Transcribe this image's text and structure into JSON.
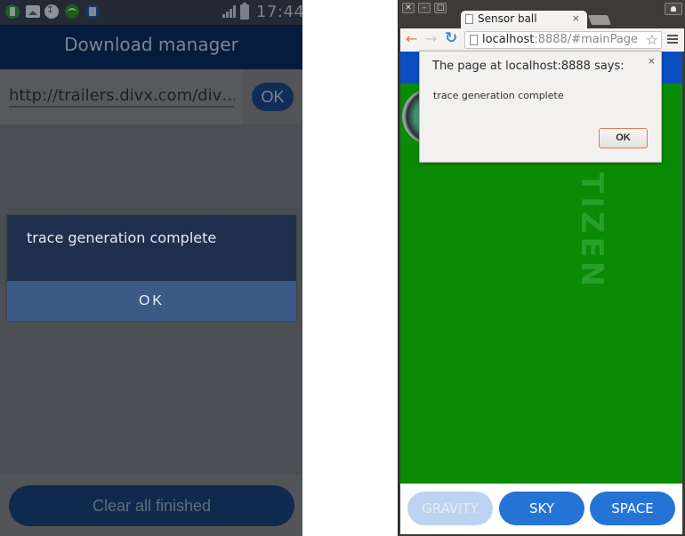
{
  "phone": {
    "status_bar": {
      "left_icons": [
        "battery-app-icon",
        "gallery-icon",
        "usb-icon",
        "wifi-icon",
        "document-icon"
      ],
      "right_icons": [
        "signal-icon",
        "battery-icon"
      ],
      "time": "17:44"
    },
    "app_bar": {
      "title": "Download manager"
    },
    "url_row": {
      "url_value": "http://trailers.divx.com/div…",
      "ok_label": "OK"
    },
    "dialog": {
      "message": "trace generation complete",
      "ok_label": "OK"
    },
    "clear_button_label": "Clear all finished",
    "colors": {
      "app_bar": "#061c3f",
      "dialog_bg": "#1f2f4e",
      "dialog_button": "#3c5a86",
      "overlay": "#4a4f54"
    }
  },
  "browser": {
    "window_controls": [
      "close",
      "minimize",
      "maximize"
    ],
    "tab": {
      "title": "Sensor ball",
      "close_glyph": "×"
    },
    "nav": {
      "back": "←",
      "forward": "→",
      "reload": "↻"
    },
    "omnibox": {
      "host": "localhost",
      "path": ":8888/#mainPage",
      "star": "☆"
    },
    "page": {
      "logo_text": "TIZEN",
      "mode_buttons": [
        {
          "label": "GRAVITY",
          "state": "disabled"
        },
        {
          "label": "SKY",
          "state": "active"
        },
        {
          "label": "SPACE",
          "state": "active"
        }
      ],
      "colors": {
        "header": "#0a4fbf",
        "field": "#0a8a05",
        "button": "#2673d6"
      }
    },
    "alert": {
      "title": "The page at localhost:8888 says:",
      "message": "trace generation complete",
      "ok_label": "OK",
      "close_glyph": "×"
    }
  }
}
